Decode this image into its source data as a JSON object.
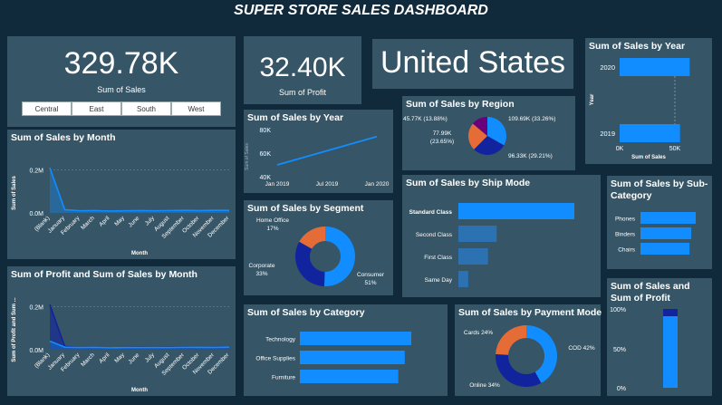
{
  "dashboard_title": "SUPER STORE SALES DASHBOARD",
  "kpis": {
    "sales_value": "329.78K",
    "sales_label": "Sum of Sales",
    "profit_value": "32.40K",
    "profit_label": "Sum of Profit",
    "country": "United States"
  },
  "region_slicer": [
    "Central",
    "East",
    "South",
    "West"
  ],
  "colors": {
    "page_bg": "#102a3b",
    "card_bg": "#365566",
    "primary": "#118dff",
    "dark_blue": "#12239e",
    "orange": "#e66c37",
    "purple": "#6b007b"
  },
  "chart_data": [
    {
      "id": "sales_by_year_bar",
      "type": "bar",
      "orientation": "horizontal",
      "title": "Sum of Sales by Year",
      "categories": [
        "2020",
        "2019"
      ],
      "values": [
        58000,
        50000
      ],
      "xlabel": "Sum of Sales",
      "ylabel": "Year",
      "x_ticks": [
        "0K",
        "50K"
      ],
      "xlim": [
        0,
        60000
      ]
    },
    {
      "id": "sales_by_month",
      "type": "area",
      "title": "Sum of Sales by Month",
      "categories": [
        "(Blank)",
        "January",
        "February",
        "March",
        "April",
        "May",
        "June",
        "July",
        "August",
        "September",
        "October",
        "November",
        "December"
      ],
      "values": [
        210000,
        15000,
        10000,
        11000,
        9000,
        10000,
        11000,
        10000,
        11000,
        12000,
        11000,
        12000,
        12000
      ],
      "xlabel": "Month",
      "ylabel": "Sum of Sales",
      "y_ticks": [
        "0.0M",
        "0.2M"
      ],
      "ylim": [
        0,
        240000
      ]
    },
    {
      "id": "profit_sales_by_month",
      "type": "area",
      "title": "Sum of Profit and Sum of Sales by Month",
      "categories": [
        "(Blank)",
        "January",
        "February",
        "March",
        "April",
        "May",
        "June",
        "July",
        "August",
        "September",
        "October",
        "November",
        "December"
      ],
      "series": [
        {
          "values": [
            210000,
            15000,
            10000,
            11000,
            9000,
            10000,
            11000,
            10000,
            11000,
            12000,
            11000,
            12000,
            12000
          ]
        },
        {
          "values": [
            40000,
            12000,
            10000,
            11000,
            9000,
            10000,
            10000,
            10000,
            10000,
            11000,
            11000,
            11000,
            12000
          ]
        }
      ],
      "xlabel": "Month",
      "ylabel": "Sum of Profit and Sum ...",
      "y_ticks": [
        "0.0M",
        "0.2M"
      ],
      "ylim": [
        0,
        240000
      ]
    },
    {
      "id": "sales_by_year_line",
      "type": "line",
      "title": "Sum of Sales by Year",
      "x": [
        "Jan 2019",
        "Jan 2020"
      ],
      "values": [
        50000,
        74000
      ],
      "x_ticks": [
        "Jan 2019",
        "Jul 2019",
        "Jan 2020"
      ],
      "y_ticks": [
        "40K",
        "60K",
        "80K"
      ],
      "ylabel": "Sum of Sales",
      "ylim": [
        40000,
        80000
      ]
    },
    {
      "id": "sales_by_segment",
      "type": "pie",
      "title": "Sum of Sales by Segment",
      "categories": [
        "Consumer",
        "Corporate",
        "Home Office"
      ],
      "values": [
        51,
        33,
        17
      ],
      "labels": [
        "Consumer\n51%",
        "Corporate\n33%",
        "Home Office\n17%"
      ]
    },
    {
      "id": "sales_by_region",
      "type": "pie",
      "title": "Sum of Sales by Region",
      "categories": [
        "109.69K (33.26%)",
        "96.33K (29.21%)",
        "77.99K (23.65%)",
        "45.77K (13.88%)"
      ],
      "values": [
        109.69,
        96.33,
        77.99,
        45.77
      ]
    },
    {
      "id": "sales_by_ship_mode",
      "type": "bar",
      "orientation": "horizontal",
      "title": "Sum of Sales by Ship Mode",
      "categories": [
        "Standard Class",
        "Second Class",
        "First Class",
        "Same Day"
      ],
      "values": [
        200,
        66,
        51,
        17
      ]
    },
    {
      "id": "sales_by_subcategory",
      "type": "bar",
      "orientation": "horizontal",
      "title": "Sum of Sales by Sub-Category",
      "categories": [
        "Phones",
        "Binders",
        "Chairs"
      ],
      "values": [
        62,
        57,
        55
      ]
    },
    {
      "id": "sales_by_category",
      "type": "bar",
      "orientation": "horizontal",
      "title": "Sum of Sales by Category",
      "categories": [
        "Technology",
        "Office Supplies",
        "Furniture"
      ],
      "values": [
        120,
        113,
        106
      ]
    },
    {
      "id": "sales_by_payment_mode",
      "type": "pie",
      "title": "Sum of Sales by Payment Mode",
      "categories": [
        "COD",
        "Online",
        "Cards"
      ],
      "values": [
        42,
        34,
        24
      ],
      "labels": [
        "COD 42%",
        "Online 34%",
        "Cards 24%"
      ]
    },
    {
      "id": "sales_profit_100pct",
      "type": "bar",
      "title": "Sum of Sales and Sum of Profit",
      "series": [
        {
          "values": [
            90.8
          ]
        },
        {
          "values": [
            9.2
          ]
        }
      ],
      "y_ticks": [
        "0%",
        "50%",
        "100%"
      ],
      "ylim": [
        0,
        100
      ]
    }
  ]
}
